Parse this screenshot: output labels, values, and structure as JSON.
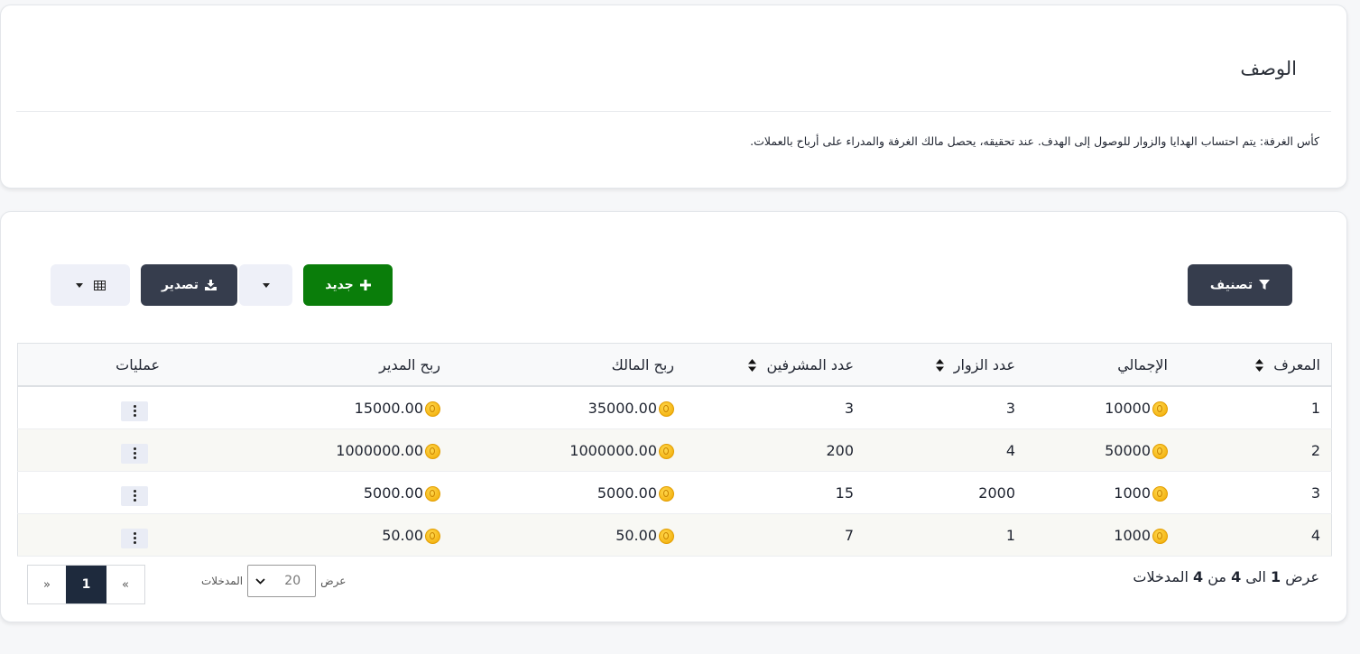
{
  "description": {
    "title": "الوصف",
    "text": "كأس الغرفة: يتم احتساب الهدايا والزوار للوصول إلى الهدف. عند تحقيقه، يحصل مالك الغرفة والمدراء على أرباح بالعملات."
  },
  "toolbar": {
    "filter_label": "تصنيف",
    "new_label": "جديد",
    "export_label": "تصدير"
  },
  "table": {
    "headers": {
      "id": "المعرف",
      "total": "الإجمالي",
      "visitors": "عدد الزوار",
      "supervisors": "عدد المشرفين",
      "owner_profit": "ربح المالك",
      "manager_profit": "ربح المدير",
      "actions": "عمليات"
    },
    "rows": [
      {
        "id": "1",
        "total": "10000",
        "visitors": "3",
        "supervisors": "3",
        "owner_profit": "35000.00",
        "manager_profit": "15000.00"
      },
      {
        "id": "2",
        "total": "50000",
        "visitors": "4",
        "supervisors": "200",
        "owner_profit": "1000000.00",
        "manager_profit": "1000000.00"
      },
      {
        "id": "3",
        "total": "1000",
        "visitors": "2000",
        "supervisors": "15",
        "owner_profit": "5000.00",
        "manager_profit": "5000.00"
      },
      {
        "id": "4",
        "total": "1000",
        "visitors": "1",
        "supervisors": "7",
        "owner_profit": "50.00",
        "manager_profit": "50.00"
      }
    ]
  },
  "footer": {
    "info_prefix": "عرض",
    "info_from": "1",
    "info_to_word": "الى",
    "info_to": "4",
    "info_of_word": "من",
    "info_total": "4",
    "info_suffix": "المدخلات",
    "length_label": "عرض",
    "length_value": "20",
    "length_suffix": "المدخلات",
    "pager_prev": "«",
    "pager_current": "1",
    "pager_next": "»"
  }
}
